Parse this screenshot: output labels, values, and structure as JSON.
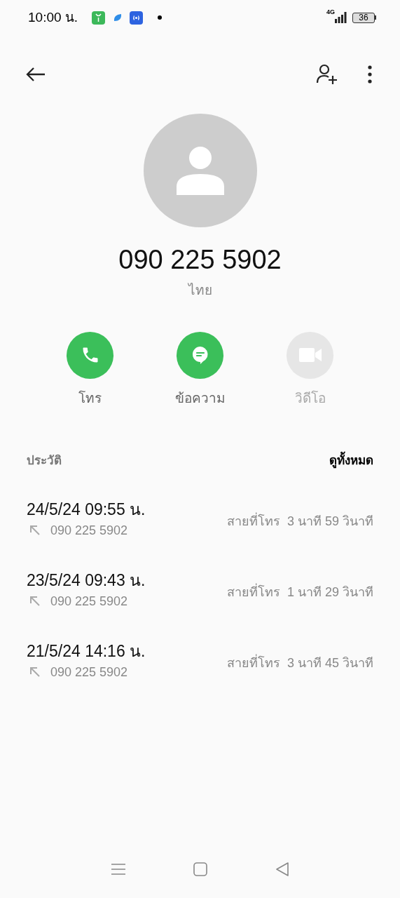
{
  "status_bar": {
    "time": "10:00 น.",
    "network": "4G",
    "battery": "36"
  },
  "contact": {
    "number": "090 225 5902",
    "location": "ไทย"
  },
  "actions": [
    {
      "kind": "call",
      "label": "โทร",
      "disabled": false
    },
    {
      "kind": "message",
      "label": "ข้อความ",
      "disabled": false
    },
    {
      "kind": "video",
      "label": "วิดีโอ",
      "disabled": true
    }
  ],
  "history": {
    "title": "ประวัติ",
    "see_all": "ดูทั้งหมด",
    "calls": [
      {
        "kind": "outgoing",
        "datetime": "24/5/24 09:55 น.",
        "number": "090 225 5902",
        "type": "สายที่โทร",
        "duration": "3 นาที 59 วินาที"
      },
      {
        "kind": "outgoing",
        "datetime": "23/5/24 09:43 น.",
        "number": "090 225 5902",
        "type": "สายที่โทร",
        "duration": "1 นาที 29 วินาที"
      },
      {
        "kind": "outgoing",
        "datetime": "21/5/24 14:16 น.",
        "number": "090 225 5902",
        "type": "สายที่โทร",
        "duration": "3 นาที 45 วินาที"
      }
    ]
  }
}
